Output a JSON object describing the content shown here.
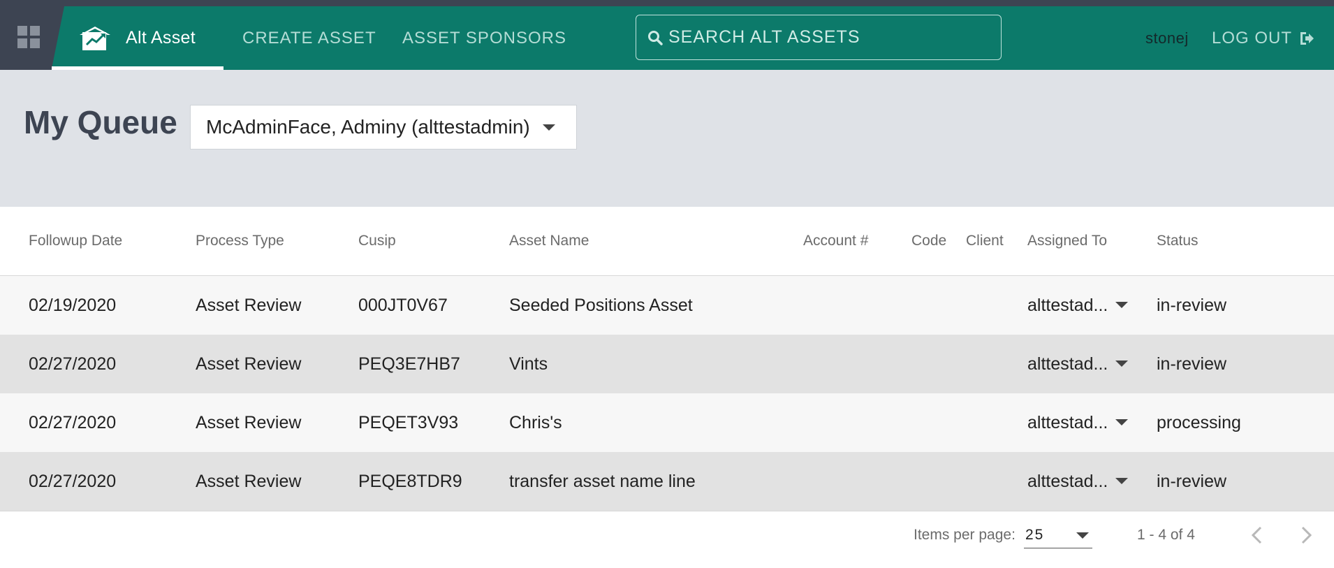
{
  "header": {
    "brand": "Alt Asset",
    "nav": [
      "CREATE ASSET",
      "ASSET SPONSORS"
    ],
    "search_placeholder": "SEARCH ALT ASSETS",
    "username": "stonej",
    "logout_label": "LOG OUT",
    "colors": {
      "nav_bg": "#0c7a6a",
      "sidebar_bg": "#3d4452"
    }
  },
  "page": {
    "title": "My Queue",
    "queue_selected": "McAdminFace, Adminy (alttestadmin)"
  },
  "table": {
    "columns": [
      "Followup Date",
      "Process Type",
      "Cusip",
      "Asset Name",
      "Account #",
      "Code",
      "Client",
      "Assigned To",
      "Status"
    ],
    "rows": [
      {
        "date": "02/19/2020",
        "process": "Asset Review",
        "cusip": "000JT0V67",
        "name": "Seeded Positions Asset",
        "account": "",
        "code": "",
        "client": "",
        "assigned": "alttestad...",
        "status": "in-review"
      },
      {
        "date": "02/27/2020",
        "process": "Asset Review",
        "cusip": "PEQ3E7HB7",
        "name": "Vints",
        "account": "",
        "code": "",
        "client": "",
        "assigned": "alttestad...",
        "status": "in-review"
      },
      {
        "date": "02/27/2020",
        "process": "Asset Review",
        "cusip": "PEQET3V93",
        "name": "Chris's",
        "account": "",
        "code": "",
        "client": "",
        "assigned": "alttestad...",
        "status": "processing"
      },
      {
        "date": "02/27/2020",
        "process": "Asset Review",
        "cusip": "PEQE8TDR9",
        "name": "transfer asset name line",
        "account": "",
        "code": "",
        "client": "",
        "assigned": "alttestad...",
        "status": "in-review"
      }
    ]
  },
  "paginator": {
    "items_label": "Items per page:",
    "page_size": "25",
    "range": "1 - 4 of 4"
  },
  "icons": [
    "apps-grid-icon",
    "alt-asset-logo-icon",
    "search-icon",
    "logout-icon",
    "chevron-left-icon",
    "chevron-right-icon"
  ]
}
